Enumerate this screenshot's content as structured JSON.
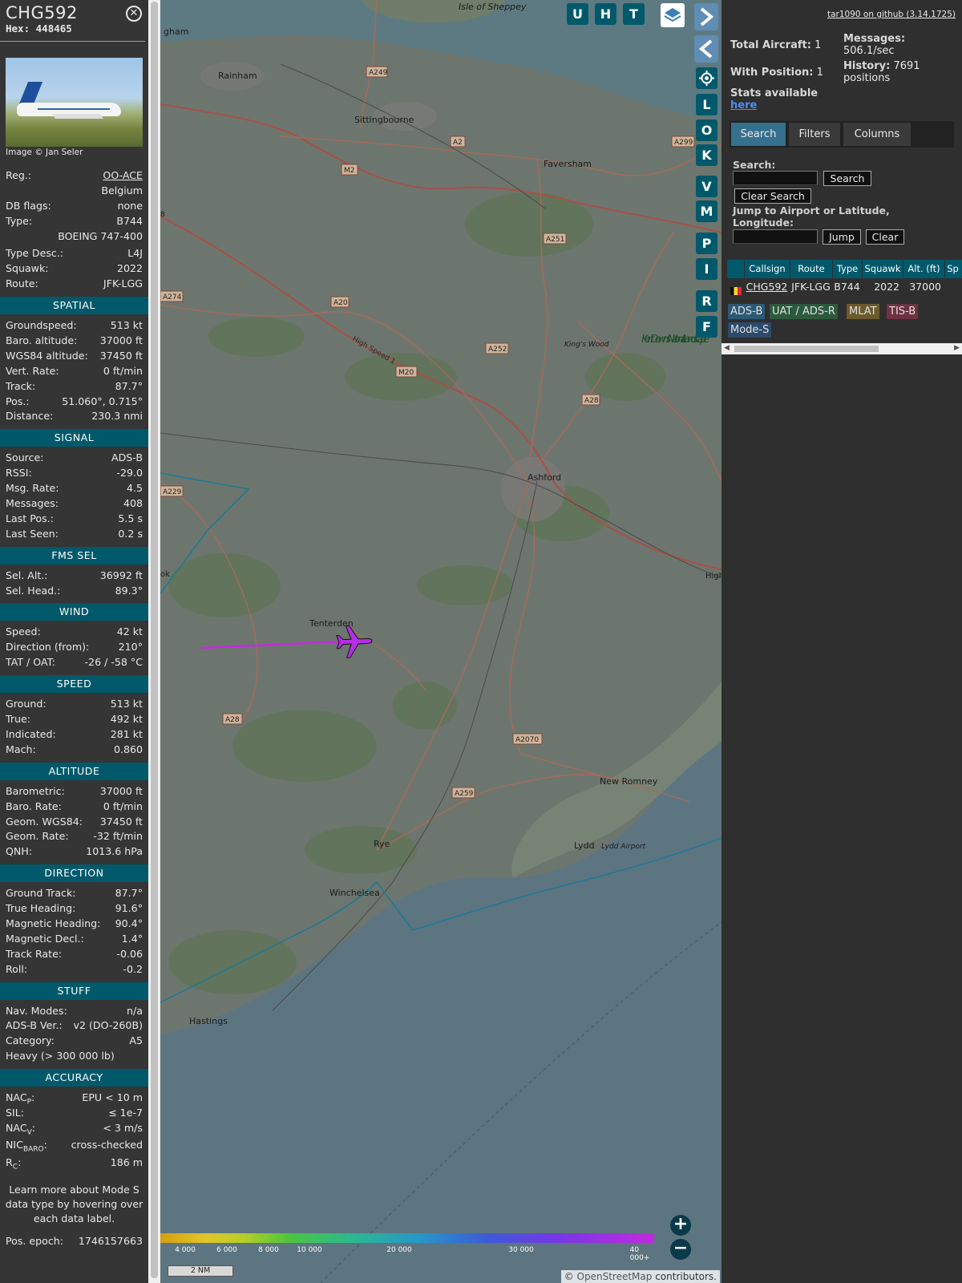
{
  "aircraft": {
    "callsign": "CHG592",
    "hex_label": "Hex:",
    "hex": "448465",
    "image_credit": "Image © Jan Seler",
    "reg_label": "Reg.:",
    "reg": "OO-ACE",
    "country": "Belgium",
    "db_flags_label": "DB flags:",
    "db_flags": "none",
    "type_label": "Type:",
    "type": "B744",
    "type_full": "BOEING 747-400",
    "type_desc_label": "Type Desc.:",
    "type_desc": "L4J",
    "squawk_label": "Squawk:",
    "squawk": "2022",
    "route_label": "Route:",
    "route": "JFK-LGG"
  },
  "sections": {
    "spatial": "SPATIAL",
    "signal": "SIGNAL",
    "fms_sel": "FMS SEL",
    "wind": "WIND",
    "speed": "SPEED",
    "altitude": "ALTITUDE",
    "direction": "DIRECTION",
    "stuff": "STUFF",
    "accuracy": "ACCURACY"
  },
  "spatial": [
    {
      "label": "Groundspeed:",
      "value": "513 kt"
    },
    {
      "label": "Baro. altitude:",
      "value": "37000 ft"
    },
    {
      "label": "WGS84 altitude:",
      "value": "37450 ft"
    },
    {
      "label": "Vert. Rate:",
      "value": "0 ft/min"
    },
    {
      "label": "Track:",
      "value": "87.7°"
    },
    {
      "label": "Pos.:",
      "value": "51.060°, 0.715°"
    },
    {
      "label": "Distance:",
      "value": "230.3 nmi"
    }
  ],
  "signal": [
    {
      "label": "Source:",
      "value": "ADS-B"
    },
    {
      "label": "RSSI:",
      "value": "-29.0"
    },
    {
      "label": "Msg. Rate:",
      "value": "4.5"
    },
    {
      "label": "Messages:",
      "value": "408"
    },
    {
      "label": "Last Pos.:",
      "value": "5.5 s"
    },
    {
      "label": "Last Seen:",
      "value": "0.2 s"
    }
  ],
  "fms_sel": [
    {
      "label": "Sel. Alt.:",
      "value": "36992 ft"
    },
    {
      "label": "Sel. Head.:",
      "value": "89.3°"
    }
  ],
  "wind": [
    {
      "label": "Speed:",
      "value": "42 kt"
    },
    {
      "label": "Direction (from):",
      "value": "210°"
    },
    {
      "label": "TAT / OAT:",
      "value": "-26 / -58 °C"
    }
  ],
  "speed": [
    {
      "label": "Ground:",
      "value": "513 kt"
    },
    {
      "label": "True:",
      "value": "492 kt"
    },
    {
      "label": "Indicated:",
      "value": "281 kt"
    },
    {
      "label": "Mach:",
      "value": "0.860"
    }
  ],
  "altitude": [
    {
      "label": "Barometric:",
      "value": "37000 ft"
    },
    {
      "label": "Baro. Rate:",
      "value": "0 ft/min"
    },
    {
      "label": "Geom. WGS84:",
      "value": "37450 ft"
    },
    {
      "label": "Geom. Rate:",
      "value": "-32 ft/min"
    },
    {
      "label": "QNH:",
      "value": "1013.6 hPa"
    }
  ],
  "direction": [
    {
      "label": "Ground Track:",
      "value": "87.7°"
    },
    {
      "label": "True Heading:",
      "value": "91.6°"
    },
    {
      "label": "Magnetic Heading:",
      "value": "90.4°"
    },
    {
      "label": "Magnetic Decl.:",
      "value": "1.4°"
    },
    {
      "label": "Track Rate:",
      "value": "-0.06"
    },
    {
      "label": "Roll:",
      "value": "-0.2"
    }
  ],
  "stuff": {
    "nav_modes_label": "Nav. Modes:",
    "nav_modes": "n/a",
    "adsb_ver_label": "ADS-B Ver.:",
    "adsb_ver": "v2 (DO-260B)",
    "category_label": "Category:",
    "category": "A5",
    "category_desc": "Heavy (> 300 000 lb)"
  },
  "accuracy": {
    "nacp_main": "NAC",
    "nacp_sub": "P",
    "nacp": "EPU < 10 m",
    "sil_label": "SIL:",
    "sil": "≤ 1e-7",
    "nacv_main": "NAC",
    "nacv_sub": "V",
    "nacv": "< 3 m/s",
    "nicbaro_main": "NIC",
    "nicbaro_sub": "BARO",
    "nicbaro": "cross-checked",
    "rc_main": "R",
    "rc_sub": "C",
    "rc": "186 m"
  },
  "note": "Learn more about Mode S data type by hovering over each data label.",
  "pos_epoch_label": "Pos. epoch:",
  "pos_epoch": "1746157663",
  "map": {
    "places": {
      "isle_of_sheppey": "Isle of Sheppey",
      "gham": "gham",
      "rainham": "Rainham",
      "sittingbourne": "Sittingbourne",
      "faversham": "Faversham",
      "ashford": "Ashford",
      "tenterden": "Tenterden",
      "new_romney": "New Romney",
      "rye": "Rye",
      "lydd": "Lydd",
      "lydd_airport": "Lydd Airport",
      "winchelsea": "Winchelsea",
      "hastings": "Hastings",
      "kings_wood": "King's Wood",
      "kent_downs": "Kent Downs National Landscape",
      "high_speed": "High Speed 1",
      "ok": "ok",
      "high": "High"
    },
    "roads": [
      "A249",
      "A2",
      "M2",
      "A299",
      "A251",
      "A274",
      "A20",
      "A252",
      "M20",
      "A28",
      "A229",
      "A28",
      "A2070",
      "A259"
    ],
    "buttons": {
      "u": "U",
      "h": "H",
      "t": "T",
      "l": "L",
      "o": "O",
      "k": "K",
      "v": "V",
      "m": "M",
      "p": "P",
      "i": "I",
      "r": "R",
      "f": "F"
    },
    "legend_labels": [
      "4 000",
      "6 000",
      "8 000",
      "10 000",
      "20 000",
      "30 000",
      "40 000+"
    ],
    "scale": "2 NM",
    "copyright_prefix": "© ",
    "copyright_link": "OpenStreetMap",
    "copyright_suffix": " contributors."
  },
  "panel": {
    "github": "tar1090 on github (3.14.1725)",
    "total_aircraft_label": "Total Aircraft:",
    "total_aircraft": "1",
    "with_position_label": "With Position:",
    "with_position": "1",
    "messages_label": "Messages:",
    "messages": "506.1/sec",
    "history_label": "History:",
    "history": "7691 positions",
    "stats_label": "Stats available",
    "stats_link": "here",
    "tabs": [
      "Search",
      "Filters",
      "Columns"
    ],
    "search_label": "Search:",
    "search_button": "Search",
    "clear_search_button": "Clear Search",
    "jump_label": "Jump to Airport or Latitude, Longitude:",
    "jump_button": "Jump",
    "clear_button": "Clear",
    "columns": [
      "Callsign",
      "Route",
      "Type",
      "Squawk",
      "Alt. (ft)",
      "Sp"
    ],
    "row": {
      "callsign": "CHG592",
      "route": "JFK-LGG",
      "type": "B744",
      "squawk": "2022",
      "alt": "37000"
    },
    "badges": [
      "ADS-B",
      "UAT / ADS-R",
      "MLAT",
      "TIS-B",
      "Mode-S"
    ]
  }
}
